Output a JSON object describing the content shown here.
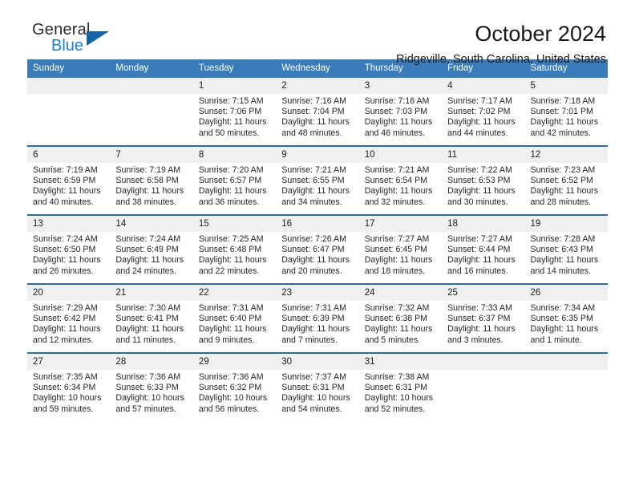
{
  "logo": {
    "primary_text": "General",
    "secondary_text": "Blue",
    "primary_color": "#2b2b2b",
    "secondary_color": "#1f7fd4",
    "triangle_color": "#1464a5"
  },
  "header": {
    "title": "October 2024",
    "location": "Ridgeville, South Carolina, United States"
  },
  "theme": {
    "header_row_bg": "#3a7cb9",
    "row_divider": "#2e6da4",
    "daynum_bg": "#f0f0f0"
  },
  "weekdays": [
    "Sunday",
    "Monday",
    "Tuesday",
    "Wednesday",
    "Thursday",
    "Friday",
    "Saturday"
  ],
  "labels": {
    "sunrise": "Sunrise:",
    "sunset": "Sunset:",
    "daylight": "Daylight:"
  },
  "weeks": [
    [
      {
        "day": "",
        "sunrise": "",
        "sunset": "",
        "daylight_line1": "",
        "daylight_line2": ""
      },
      {
        "day": "",
        "sunrise": "",
        "sunset": "",
        "daylight_line1": "",
        "daylight_line2": ""
      },
      {
        "day": "1",
        "sunrise": "Sunrise: 7:15 AM",
        "sunset": "Sunset: 7:06 PM",
        "daylight_line1": "Daylight: 11 hours",
        "daylight_line2": "and 50 minutes."
      },
      {
        "day": "2",
        "sunrise": "Sunrise: 7:16 AM",
        "sunset": "Sunset: 7:04 PM",
        "daylight_line1": "Daylight: 11 hours",
        "daylight_line2": "and 48 minutes."
      },
      {
        "day": "3",
        "sunrise": "Sunrise: 7:16 AM",
        "sunset": "Sunset: 7:03 PM",
        "daylight_line1": "Daylight: 11 hours",
        "daylight_line2": "and 46 minutes."
      },
      {
        "day": "4",
        "sunrise": "Sunrise: 7:17 AM",
        "sunset": "Sunset: 7:02 PM",
        "daylight_line1": "Daylight: 11 hours",
        "daylight_line2": "and 44 minutes."
      },
      {
        "day": "5",
        "sunrise": "Sunrise: 7:18 AM",
        "sunset": "Sunset: 7:01 PM",
        "daylight_line1": "Daylight: 11 hours",
        "daylight_line2": "and 42 minutes."
      }
    ],
    [
      {
        "day": "6",
        "sunrise": "Sunrise: 7:19 AM",
        "sunset": "Sunset: 6:59 PM",
        "daylight_line1": "Daylight: 11 hours",
        "daylight_line2": "and 40 minutes."
      },
      {
        "day": "7",
        "sunrise": "Sunrise: 7:19 AM",
        "sunset": "Sunset: 6:58 PM",
        "daylight_line1": "Daylight: 11 hours",
        "daylight_line2": "and 38 minutes."
      },
      {
        "day": "8",
        "sunrise": "Sunrise: 7:20 AM",
        "sunset": "Sunset: 6:57 PM",
        "daylight_line1": "Daylight: 11 hours",
        "daylight_line2": "and 36 minutes."
      },
      {
        "day": "9",
        "sunrise": "Sunrise: 7:21 AM",
        "sunset": "Sunset: 6:55 PM",
        "daylight_line1": "Daylight: 11 hours",
        "daylight_line2": "and 34 minutes."
      },
      {
        "day": "10",
        "sunrise": "Sunrise: 7:21 AM",
        "sunset": "Sunset: 6:54 PM",
        "daylight_line1": "Daylight: 11 hours",
        "daylight_line2": "and 32 minutes."
      },
      {
        "day": "11",
        "sunrise": "Sunrise: 7:22 AM",
        "sunset": "Sunset: 6:53 PM",
        "daylight_line1": "Daylight: 11 hours",
        "daylight_line2": "and 30 minutes."
      },
      {
        "day": "12",
        "sunrise": "Sunrise: 7:23 AM",
        "sunset": "Sunset: 6:52 PM",
        "daylight_line1": "Daylight: 11 hours",
        "daylight_line2": "and 28 minutes."
      }
    ],
    [
      {
        "day": "13",
        "sunrise": "Sunrise: 7:24 AM",
        "sunset": "Sunset: 6:50 PM",
        "daylight_line1": "Daylight: 11 hours",
        "daylight_line2": "and 26 minutes."
      },
      {
        "day": "14",
        "sunrise": "Sunrise: 7:24 AM",
        "sunset": "Sunset: 6:49 PM",
        "daylight_line1": "Daylight: 11 hours",
        "daylight_line2": "and 24 minutes."
      },
      {
        "day": "15",
        "sunrise": "Sunrise: 7:25 AM",
        "sunset": "Sunset: 6:48 PM",
        "daylight_line1": "Daylight: 11 hours",
        "daylight_line2": "and 22 minutes."
      },
      {
        "day": "16",
        "sunrise": "Sunrise: 7:26 AM",
        "sunset": "Sunset: 6:47 PM",
        "daylight_line1": "Daylight: 11 hours",
        "daylight_line2": "and 20 minutes."
      },
      {
        "day": "17",
        "sunrise": "Sunrise: 7:27 AM",
        "sunset": "Sunset: 6:45 PM",
        "daylight_line1": "Daylight: 11 hours",
        "daylight_line2": "and 18 minutes."
      },
      {
        "day": "18",
        "sunrise": "Sunrise: 7:27 AM",
        "sunset": "Sunset: 6:44 PM",
        "daylight_line1": "Daylight: 11 hours",
        "daylight_line2": "and 16 minutes."
      },
      {
        "day": "19",
        "sunrise": "Sunrise: 7:28 AM",
        "sunset": "Sunset: 6:43 PM",
        "daylight_line1": "Daylight: 11 hours",
        "daylight_line2": "and 14 minutes."
      }
    ],
    [
      {
        "day": "20",
        "sunrise": "Sunrise: 7:29 AM",
        "sunset": "Sunset: 6:42 PM",
        "daylight_line1": "Daylight: 11 hours",
        "daylight_line2": "and 12 minutes."
      },
      {
        "day": "21",
        "sunrise": "Sunrise: 7:30 AM",
        "sunset": "Sunset: 6:41 PM",
        "daylight_line1": "Daylight: 11 hours",
        "daylight_line2": "and 11 minutes."
      },
      {
        "day": "22",
        "sunrise": "Sunrise: 7:31 AM",
        "sunset": "Sunset: 6:40 PM",
        "daylight_line1": "Daylight: 11 hours",
        "daylight_line2": "and 9 minutes."
      },
      {
        "day": "23",
        "sunrise": "Sunrise: 7:31 AM",
        "sunset": "Sunset: 6:39 PM",
        "daylight_line1": "Daylight: 11 hours",
        "daylight_line2": "and 7 minutes."
      },
      {
        "day": "24",
        "sunrise": "Sunrise: 7:32 AM",
        "sunset": "Sunset: 6:38 PM",
        "daylight_line1": "Daylight: 11 hours",
        "daylight_line2": "and 5 minutes."
      },
      {
        "day": "25",
        "sunrise": "Sunrise: 7:33 AM",
        "sunset": "Sunset: 6:37 PM",
        "daylight_line1": "Daylight: 11 hours",
        "daylight_line2": "and 3 minutes."
      },
      {
        "day": "26",
        "sunrise": "Sunrise: 7:34 AM",
        "sunset": "Sunset: 6:35 PM",
        "daylight_line1": "Daylight: 11 hours",
        "daylight_line2": "and 1 minute."
      }
    ],
    [
      {
        "day": "27",
        "sunrise": "Sunrise: 7:35 AM",
        "sunset": "Sunset: 6:34 PM",
        "daylight_line1": "Daylight: 10 hours",
        "daylight_line2": "and 59 minutes."
      },
      {
        "day": "28",
        "sunrise": "Sunrise: 7:36 AM",
        "sunset": "Sunset: 6:33 PM",
        "daylight_line1": "Daylight: 10 hours",
        "daylight_line2": "and 57 minutes."
      },
      {
        "day": "29",
        "sunrise": "Sunrise: 7:36 AM",
        "sunset": "Sunset: 6:32 PM",
        "daylight_line1": "Daylight: 10 hours",
        "daylight_line2": "and 56 minutes."
      },
      {
        "day": "30",
        "sunrise": "Sunrise: 7:37 AM",
        "sunset": "Sunset: 6:31 PM",
        "daylight_line1": "Daylight: 10 hours",
        "daylight_line2": "and 54 minutes."
      },
      {
        "day": "31",
        "sunrise": "Sunrise: 7:38 AM",
        "sunset": "Sunset: 6:31 PM",
        "daylight_line1": "Daylight: 10 hours",
        "daylight_line2": "and 52 minutes."
      },
      {
        "day": "",
        "sunrise": "",
        "sunset": "",
        "daylight_line1": "",
        "daylight_line2": ""
      },
      {
        "day": "",
        "sunrise": "",
        "sunset": "",
        "daylight_line1": "",
        "daylight_line2": ""
      }
    ]
  ]
}
